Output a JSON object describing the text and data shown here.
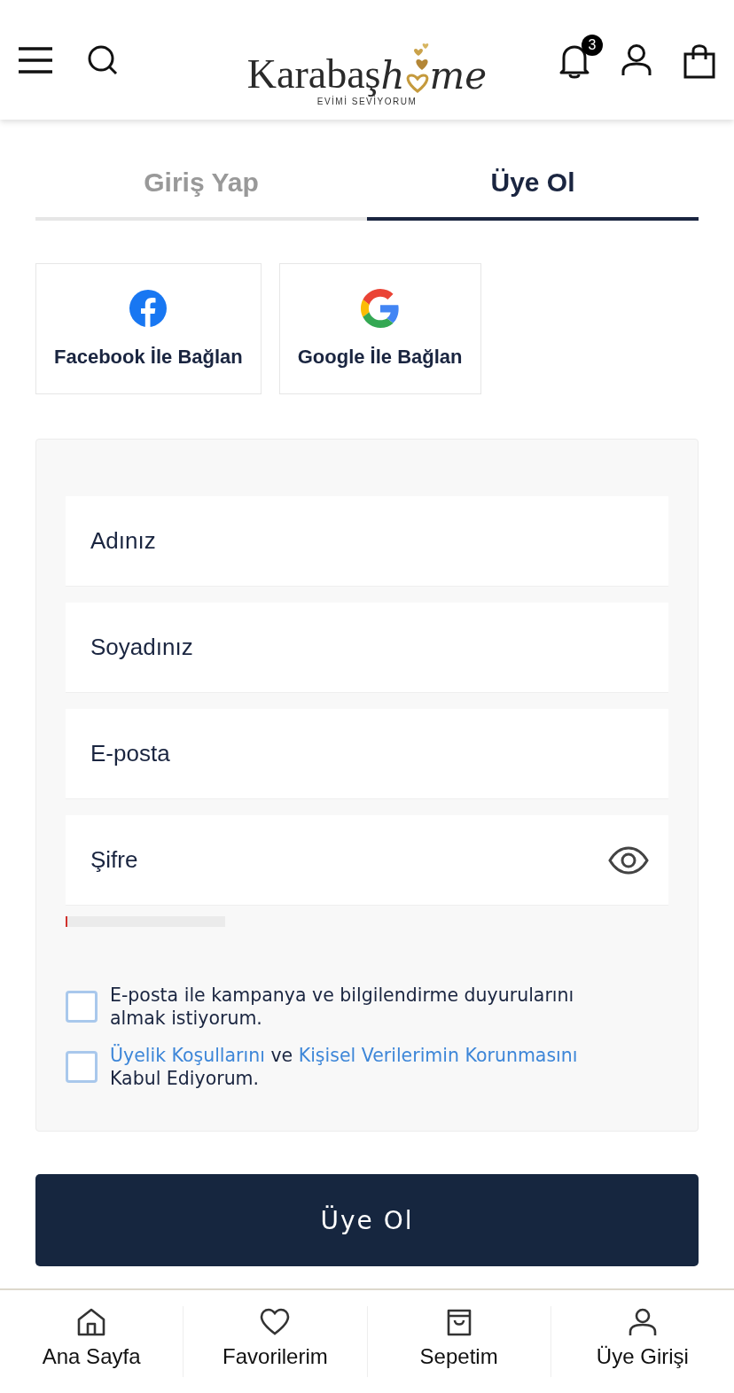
{
  "header": {
    "logo": {
      "serif_part": "Karabaş",
      "script_start": "h",
      "script_end": "me",
      "tagline": "EVİMİ SEVİYORUM"
    },
    "notification_count": "3"
  },
  "tabs": [
    {
      "label": "Giriş Yap",
      "selected": false
    },
    {
      "label": "Üye Ol",
      "selected": true
    }
  ],
  "social_buttons": [
    {
      "kind": "facebook",
      "label": "Facebook İle Bağlan"
    },
    {
      "kind": "google",
      "label": "Google İle Bağlan"
    }
  ],
  "fields": [
    {
      "placeholder": "Adınız",
      "kind": "text"
    },
    {
      "placeholder": "Soyadınız",
      "kind": "text"
    },
    {
      "placeholder": "E-posta",
      "kind": "email"
    },
    {
      "placeholder": "Şifre",
      "kind": "password"
    }
  ],
  "password_strength": {
    "level": 0.01
  },
  "consents": [
    {
      "checked": false,
      "parts": [
        {
          "kind": "text",
          "text": "E-posta ile kampanya ve bilgilendirme duyurularını almak istiyorum."
        }
      ]
    },
    {
      "checked": false,
      "parts": [
        {
          "kind": "link",
          "text": "Üyelik Koşullarını"
        },
        {
          "kind": "text",
          "text": " ve "
        },
        {
          "kind": "link",
          "text": "Kişisel Verilerimin Korunmasını"
        },
        {
          "kind": "text",
          "text": " Kabul Ediyorum."
        }
      ]
    }
  ],
  "submit_button": "Üye Ol",
  "bottom_nav": [
    {
      "kind": "home",
      "label": "Ana Sayfa"
    },
    {
      "kind": "heart",
      "label": "Favorilerim"
    },
    {
      "kind": "bag",
      "label": "Sepetim"
    },
    {
      "kind": "user",
      "label": "Üye Girişi"
    }
  ]
}
